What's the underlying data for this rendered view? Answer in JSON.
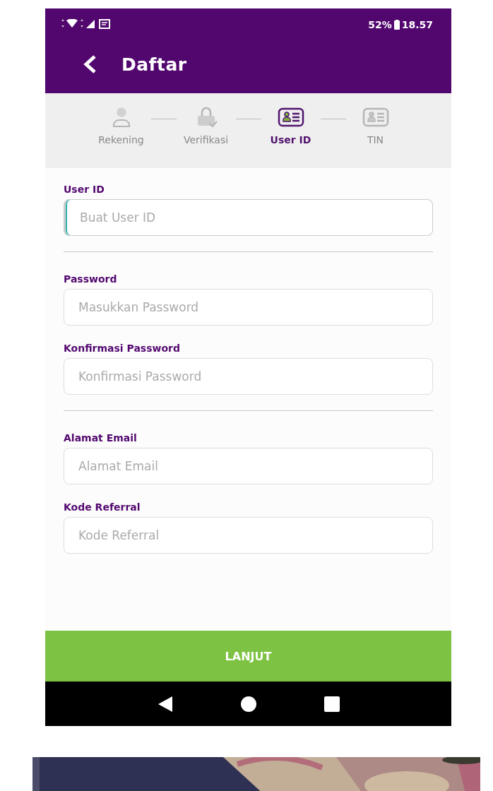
{
  "status_bar": {
    "battery": "52%",
    "time": "18.57"
  },
  "header": {
    "title": "Daftar"
  },
  "steps": [
    {
      "label": "Rekening",
      "kind": "person",
      "selected": false
    },
    {
      "label": "Verifikasi",
      "kind": "lock",
      "selected": false
    },
    {
      "label": "User ID",
      "kind": "card",
      "selected": true
    },
    {
      "label": "TIN",
      "kind": "card",
      "selected": false
    }
  ],
  "form_groups": [
    {
      "fields": [
        {
          "label": "User ID",
          "placeholder": "Buat User ID",
          "focused": true
        }
      ]
    },
    {
      "fields": [
        {
          "label": "Password",
          "placeholder": "Masukkan Password",
          "focused": false
        },
        {
          "label": "Konfirmasi Password",
          "placeholder": "Konfirmasi Password",
          "focused": false
        }
      ]
    },
    {
      "fields": [
        {
          "label": "Alamat Email",
          "placeholder": "Alamat Email",
          "focused": false
        },
        {
          "label": "Kode Referral",
          "placeholder": "Kode Referral",
          "focused": false
        }
      ]
    }
  ],
  "submit_button": "LANJUT"
}
